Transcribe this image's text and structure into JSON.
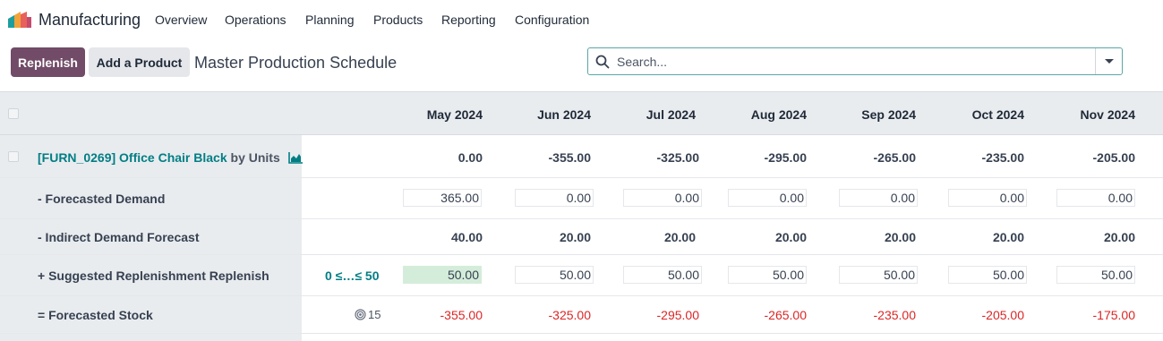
{
  "app": {
    "name": "Manufacturing",
    "icon": "manufacturing-app-icon"
  },
  "nav": [
    "Overview",
    "Operations",
    "Planning",
    "Products",
    "Reporting",
    "Configuration"
  ],
  "actions": {
    "replenish": "Replenish",
    "add_product": "Add a Product"
  },
  "page_title": "Master Production Schedule",
  "search": {
    "placeholder": "Search...",
    "value": ""
  },
  "months": [
    "May 2024",
    "Jun 2024",
    "Jul 2024",
    "Aug 2024",
    "Sep 2024",
    "Oct 2024",
    "Nov 2024"
  ],
  "product": {
    "name": "[FURN_0269] Office Chair Black",
    "uom_text": "by Units",
    "values": [
      "0.00",
      "-355.00",
      "-325.00",
      "-295.00",
      "-265.00",
      "-235.00",
      "-205.00"
    ]
  },
  "rows": {
    "forecasted_demand": {
      "label": "- Forecasted Demand",
      "values": [
        "365.00",
        "0.00",
        "0.00",
        "0.00",
        "0.00",
        "0.00",
        "0.00"
      ]
    },
    "indirect_demand": {
      "label": "- Indirect Demand Forecast",
      "values": [
        "40.00",
        "20.00",
        "20.00",
        "20.00",
        "20.00",
        "20.00",
        "20.00"
      ]
    },
    "suggested_replenishment": {
      "label": "+ Suggested Replenishment",
      "action_label": "Replenish",
      "range": "0 ≤…≤ 50",
      "values": [
        "50.00",
        "50.00",
        "50.00",
        "50.00",
        "50.00",
        "50.00",
        "50.00"
      ],
      "highlight_first": true
    },
    "forecasted_stock": {
      "label": "= Forecasted Stock",
      "safety_stock": "15",
      "values": [
        "-355.00",
        "-325.00",
        "-295.00",
        "-265.00",
        "-235.00",
        "-205.00",
        "-175.00"
      ]
    }
  },
  "colors": {
    "brand": "#714B67",
    "teal": "#017e84",
    "negative": "#dc2626",
    "highlight": "#d4edda"
  }
}
